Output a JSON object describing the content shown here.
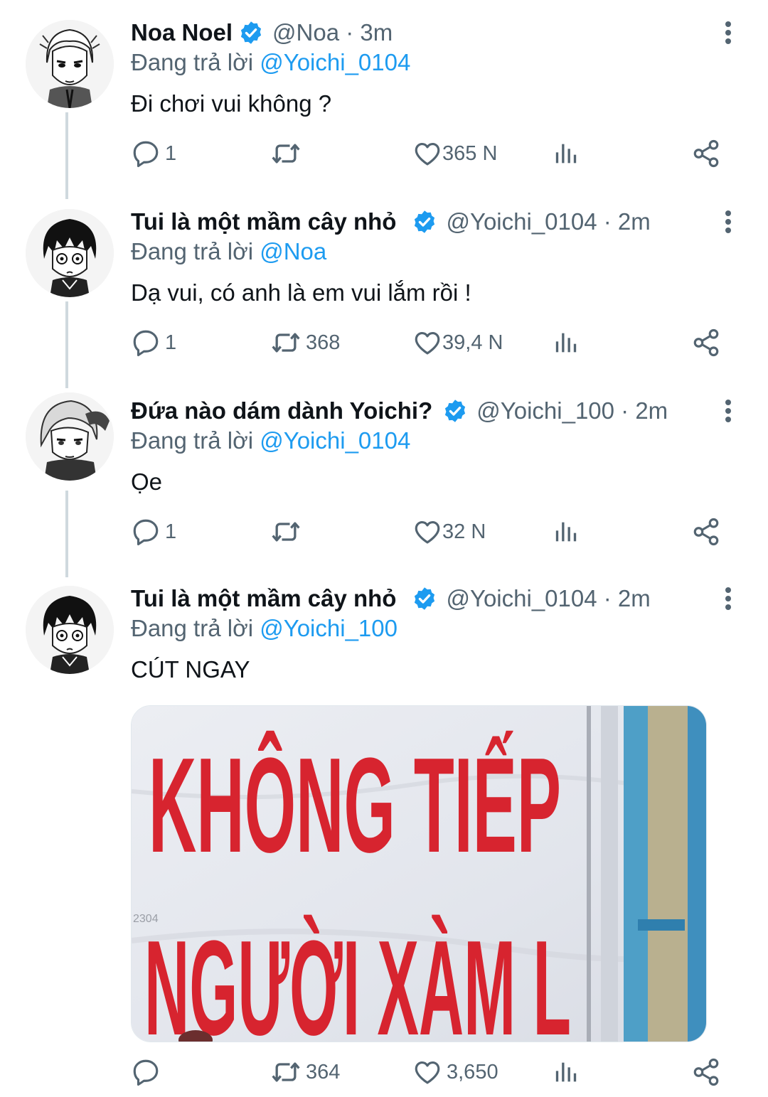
{
  "colors": {
    "accent": "#1d9bf0",
    "muted": "#536471",
    "text": "#0f1419",
    "thread_line": "#cfd9de"
  },
  "reply_prefix": "Đang trả lời",
  "tweets": [
    {
      "name": "Noa Noel",
      "handle_time": "@Noa · 3m",
      "reply_to": "@Yoichi_0104",
      "text": "Đi chơi vui không ?",
      "replies": "1",
      "retweets": "",
      "likes": "365 N"
    },
    {
      "name": "Tui là một mầm cây nhỏ",
      "handle_time": "@Yoichi_0104 · 2m",
      "reply_to": "@Noa",
      "text": "Dạ vui, có anh là em vui lắm rồi !",
      "replies": "1",
      "retweets": "368",
      "likes": "39,4 N"
    },
    {
      "name": "Đứa nào dám dành Yoichi?",
      "handle_time": "@Yoichi_100 · 2m",
      "reply_to": "@Yoichi_0104",
      "text": "Ọe",
      "replies": "1",
      "retweets": "",
      "likes": "32 N"
    },
    {
      "name": "Tui là một mầm cây nhỏ",
      "handle_time": "@Yoichi_0104 · 2m",
      "reply_to": "@Yoichi_100",
      "text": "CÚT NGAY",
      "replies": "",
      "retweets": "364",
      "likes": "3,650",
      "media": {
        "line1": "KHÔNG TIẾP",
        "line2": "NGƯỜI XÀM L",
        "corner_mark": "2304"
      }
    }
  ],
  "icons": {
    "reply": "reply-icon",
    "retweet": "retweet-icon",
    "like": "heart-icon",
    "views": "views-icon",
    "share": "share-icon",
    "verified": "verified-badge-icon",
    "more": "more-options-icon"
  }
}
